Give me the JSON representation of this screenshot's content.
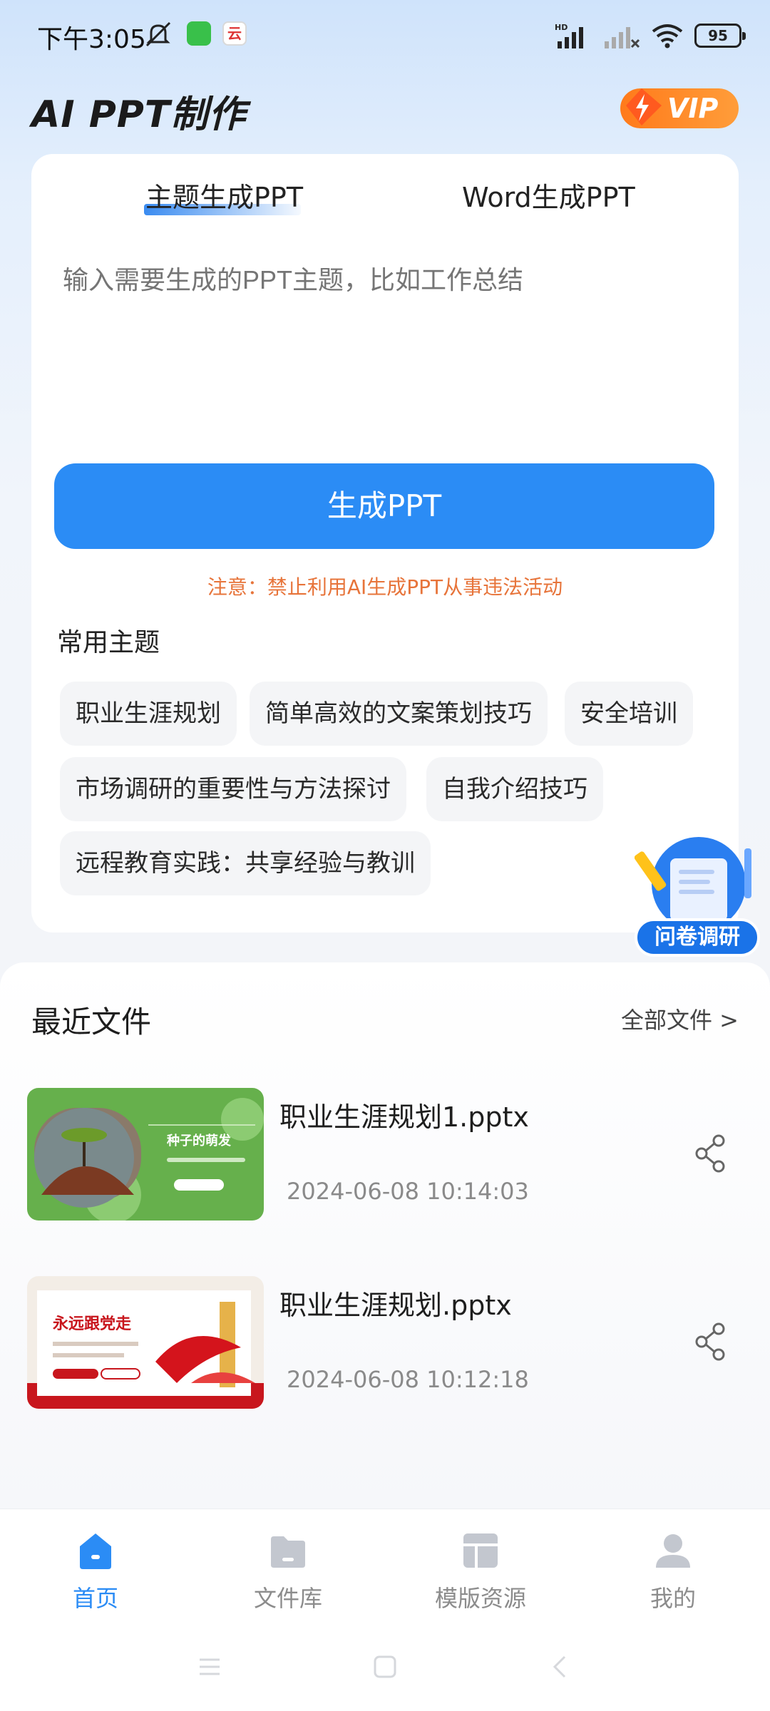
{
  "status_bar": {
    "time": "下午3:05",
    "battery": "95",
    "app2_glyph": "云"
  },
  "header": {
    "title": "AI PPT制作",
    "vip_label": "VIP"
  },
  "generator": {
    "tabs": [
      "主题生成PPT",
      "Word生成PPT"
    ],
    "active_tab": 0,
    "placeholder": "输入需要生成的PPT主题，比如工作总结",
    "button": "生成PPT",
    "notice": "注意：禁止利用AI生成PPT从事违法活动",
    "common_title": "常用主题",
    "chips": [
      "职业生涯规划",
      "简单高效的文案策划技巧",
      "安全培训",
      "市场调研的重要性与方法探讨",
      "自我介绍技巧",
      "远程教育实践：共享经验与教训"
    ]
  },
  "survey": {
    "label": "问卷调研"
  },
  "recent": {
    "title": "最近文件",
    "all_files": "全部文件 >",
    "files": [
      {
        "name": "职业生涯规划1.pptx",
        "time": "2024-06-08 10:14:03",
        "thumb_title": "种子的萌发",
        "thumb_color": "#62ad4a"
      },
      {
        "name": "职业生涯规划.pptx",
        "time": "2024-06-08 10:12:18",
        "thumb_title": "永远跟党走",
        "thumb_color": "#c8161d"
      }
    ]
  },
  "nav": {
    "items": [
      {
        "label": "首页",
        "icon": "home-icon",
        "active": true
      },
      {
        "label": "文件库",
        "icon": "folder-icon",
        "active": false
      },
      {
        "label": "模版资源",
        "icon": "template-icon",
        "active": false
      },
      {
        "label": "我的",
        "icon": "user-icon",
        "active": false
      }
    ]
  },
  "colors": {
    "accent": "#2b8cf5",
    "notice": "#e7743a",
    "vip": "#ff7a1a"
  }
}
